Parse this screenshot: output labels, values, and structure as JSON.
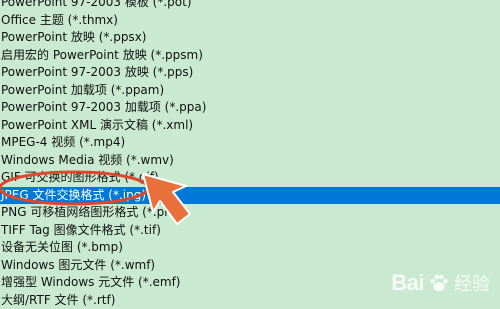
{
  "file_types": [
    {
      "label": "PowerPoint 97-2003 模板 (*.pot)"
    },
    {
      "label": "Office 主题 (*.thmx)"
    },
    {
      "label": "PowerPoint 放映 (*.ppsx)"
    },
    {
      "label": "启用宏的 PowerPoint 放映 (*.ppsm)"
    },
    {
      "label": "PowerPoint 97-2003 放映 (*.pps)"
    },
    {
      "label": "PowerPoint 加载项 (*.ppam)"
    },
    {
      "label": "PowerPoint 97-2003 加载项 (*.ppa)"
    },
    {
      "label": "PowerPoint XML 演示文稿 (*.xml)"
    },
    {
      "label": "MPEG-4 视频 (*.mp4)"
    },
    {
      "label": "Windows Media 视频 (*.wmv)"
    },
    {
      "label": "GIF 可交换的图形格式 (*.gif)"
    },
    {
      "label": "JPEG 文件交换格式 (*.jpg)",
      "selected": true
    },
    {
      "label": "PNG 可移植网络图形格式 (*.png)"
    },
    {
      "label": "TIFF Tag 图像文件格式 (*.tif)"
    },
    {
      "label": "设备无关位图 (*.bmp)"
    },
    {
      "label": "Windows 图元文件 (*.wmf)"
    },
    {
      "label": "增强型 Windows 元文件 (*.emf)"
    },
    {
      "label": "大纲/RTF 文件 (*.rtf)"
    }
  ],
  "colors": {
    "background": "#c9ead0",
    "selected_background": "#0078d7",
    "selected_text": "#ffffff",
    "annotation": "#e0462b",
    "arrow": "#e8703a"
  },
  "watermark": {
    "logo": "Bai",
    "text": "经验"
  }
}
